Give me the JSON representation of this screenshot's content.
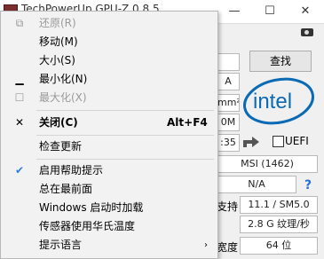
{
  "window": {
    "title": "TechPowerUp GPU-Z 0.8.5",
    "controls": {
      "minimize": "—",
      "maximize": "☐",
      "close": "✕"
    }
  },
  "background": {
    "lookup_button": "查找",
    "field_a": "A",
    "field_mm2": "mm²",
    "field_m": "0M",
    "field_35": ":35",
    "uefi_label": "UEFI",
    "subvendor": "MSI (1462)",
    "field_na": "N/A",
    "support_label": "支持",
    "shader_model": "11.1 / SM5.0",
    "texture_fill": "2.8 G 纹理/秒",
    "bus_width_label": "宽度",
    "bus_width": "64 位",
    "help": "?",
    "logo_text": "intel"
  },
  "menu": {
    "items": [
      {
        "id": "restore",
        "label": "还原(R)",
        "icon": "restore-icon",
        "icon_glyph": "⧉",
        "enabled": false
      },
      {
        "id": "move",
        "label": "移动(M)",
        "enabled": true
      },
      {
        "id": "size",
        "label": "大小(S)",
        "enabled": true
      },
      {
        "id": "minimize",
        "label": "最小化(N)",
        "icon": "minimize-icon",
        "icon_glyph": "▁",
        "enabled": true
      },
      {
        "id": "maximize",
        "label": "最大化(X)",
        "icon": "maximize-icon",
        "icon_glyph": "☐",
        "enabled": false
      },
      {
        "id": "close",
        "label": "关闭(C)",
        "icon": "close-icon",
        "icon_glyph": "✕",
        "shortcut": "Alt+F4",
        "enabled": true,
        "bold": true
      },
      {
        "id": "check-updates",
        "label": "检查更新",
        "enabled": true
      },
      {
        "id": "help-tips",
        "label": "启用帮助提示",
        "icon": "checkmark-icon",
        "icon_glyph": "✔",
        "checked": true,
        "enabled": true
      },
      {
        "id": "always-on-top",
        "label": "总在最前面",
        "enabled": true
      },
      {
        "id": "load-on-startup",
        "label": "Windows 启动时加载",
        "enabled": true
      },
      {
        "id": "fahrenheit",
        "label": "传感器使用华氏温度",
        "enabled": true
      },
      {
        "id": "language",
        "label": "提示语言",
        "submenu_glyph": "›",
        "enabled": true
      }
    ]
  },
  "colors": {
    "accent": "#2a7fe0",
    "intel_blue": "#0a6ab4",
    "disabled_text": "#9a9a9a"
  }
}
